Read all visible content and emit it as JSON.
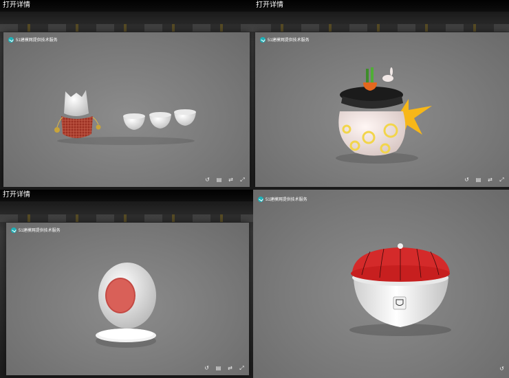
{
  "panels": [
    {
      "id": "p1",
      "header": "打开详情",
      "brand": "51建模网提供技术服务",
      "object_icon": "cat-tea-set-icon"
    },
    {
      "id": "p2",
      "header": "打开详情",
      "brand": "51建模网提供技术服务",
      "object_icon": "moon-rabbit-teapot-icon"
    },
    {
      "id": "p3",
      "header": "打开详情",
      "brand": "51建模网提供技术服务",
      "object_icon": "round-stand-ornament-icon"
    },
    {
      "id": "p4",
      "header": "",
      "brand": "51建模网提供技术服务",
      "object_icon": "red-lid-bowl-icon"
    }
  ],
  "tools": [
    "history-icon",
    "camera-icon",
    "share-icon",
    "fullscreen-icon"
  ],
  "colors": {
    "brand_teal": "#1fb2b9",
    "viewer_gray": "#7a7a7a",
    "lid_red": "#d42a2a",
    "star_yellow": "#f7b718"
  }
}
